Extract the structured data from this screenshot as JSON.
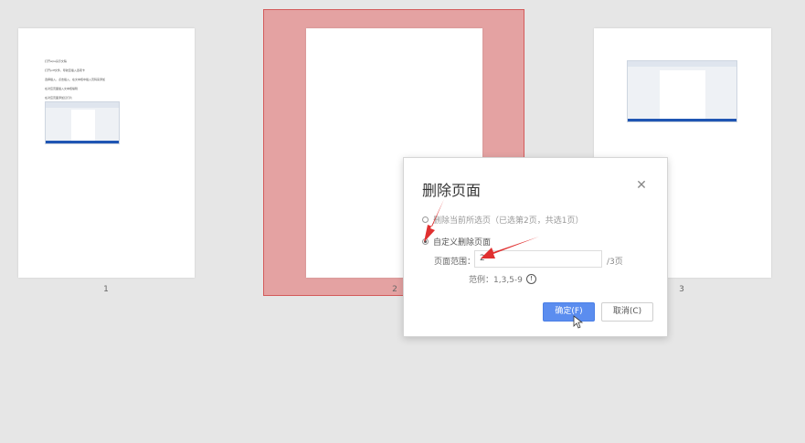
{
  "pages": [
    {
      "number": "1",
      "lines": [
        "打开wps演示文稿",
        "打开pdf文件，导航至插入选项卡",
        "选择插入，点击插入，在文本框中插入页码来添加",
        "在对应页面插入文本框编辑",
        "在对应页面添加幻灯片"
      ]
    },
    {
      "number": "2"
    },
    {
      "number": "3"
    }
  ],
  "dialog": {
    "title": "删除页面",
    "close_icon": "close-icon",
    "option_current": "删除当前所选页（已选第2页，共选1页）",
    "option_custom": "自定义删除页面",
    "range_label": "页面范围：",
    "range_value": "2",
    "range_total": "/3页",
    "example": "范例：1,3,5-9",
    "info_icon": "info-icon",
    "ok_label": "确定(F)",
    "cancel_label": "取消(C)"
  },
  "colors": {
    "selection_fill": "#e4a2a2",
    "selection_border": "#d35b5b",
    "ok_button": "#5b8def",
    "annotation_arrow": "#e03030"
  }
}
